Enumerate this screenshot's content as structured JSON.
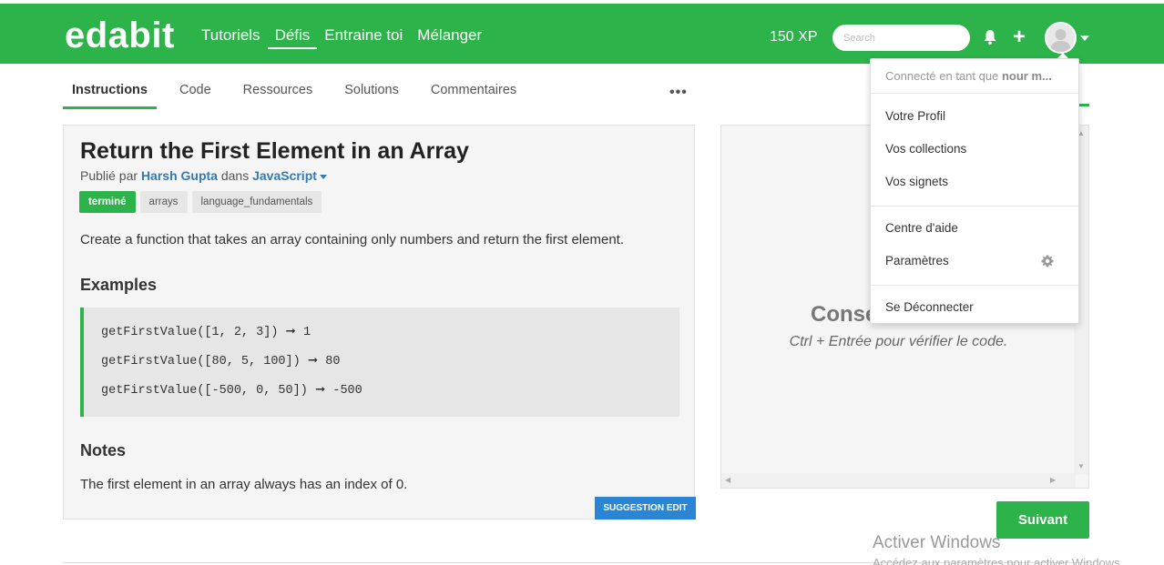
{
  "header": {
    "logo": "edabit",
    "nav": [
      "Tutoriels",
      "Défis",
      "Entraine toi",
      "Mélanger"
    ],
    "active_nav": "Défis",
    "xp": "150 XP",
    "search_placeholder": "Search",
    "brand_color": "#2cb34a"
  },
  "tabs": [
    "Instructions",
    "Code",
    "Ressources",
    "Solutions",
    "Commentaires"
  ],
  "more_label": "•••",
  "challenge": {
    "title": "Return the First Element in an Array",
    "published_by": "Publié par",
    "author": "Harsh Gupta",
    "in": "dans",
    "language": "JavaScript",
    "tags": [
      "terminé",
      "arrays",
      "language_fundamentals"
    ],
    "description": "Create a function that takes an array containing only numbers and return the first element.",
    "examples_heading": "Examples",
    "examples": [
      "getFirstValue([1, 2, 3]) ➞ 1",
      "getFirstValue([80, 5, 100]) ➞ 80",
      "getFirstValue([-500, 0, 50]) ➞ -500"
    ],
    "notes_heading": "Notes",
    "notes": "The first element in an array always has an index of 0.",
    "suggest_edit": "SUGGESTION EDIT"
  },
  "console": {
    "title": "Conse",
    "subtitle": "Ctrl + Entrée pour vérifier le code."
  },
  "next_button": "Suivant",
  "dropdown": {
    "connected_as": "Connecté en tant que",
    "username": "nour m...",
    "items_group1": [
      "Votre Profil",
      "Vos collections",
      "Vos signets"
    ],
    "items_group2": [
      "Centre d'aide",
      "Paramètres"
    ],
    "logout": "Se Déconnecter"
  },
  "watermark": {
    "title": "Activer Windows",
    "subtitle": "Accédez aux paramètres pour activer Windows."
  }
}
